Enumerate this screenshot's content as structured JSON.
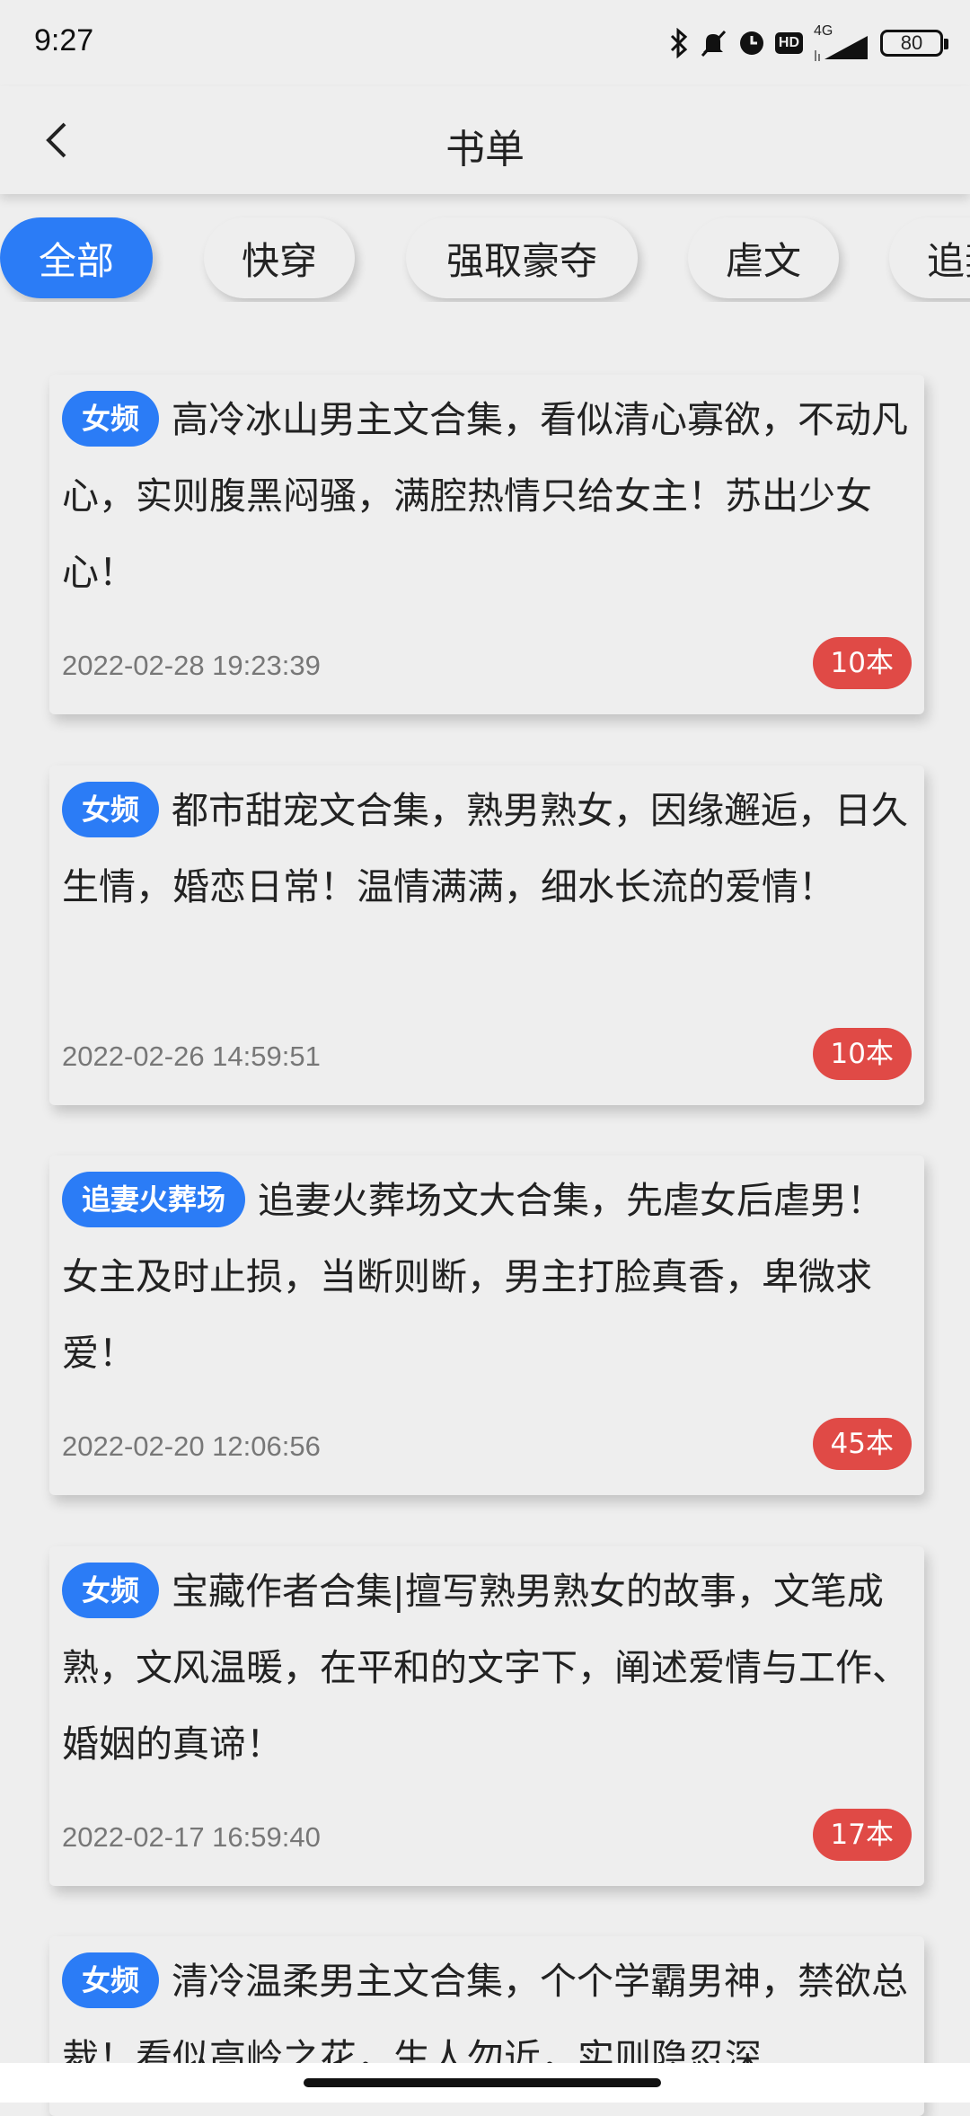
{
  "status_bar": {
    "time": "9:27",
    "icons": [
      "bluetooth-icon",
      "mute-icon",
      "alarm-icon",
      "hd-icon",
      "signal-icon",
      "battery-icon"
    ],
    "hd_label": "HD",
    "network": "4G",
    "battery": "80"
  },
  "header": {
    "title": "书单",
    "back_icon": "chevron-left-icon"
  },
  "tabs": [
    {
      "label": "全部",
      "active": true
    },
    {
      "label": "快穿",
      "active": false
    },
    {
      "label": "强取豪夺",
      "active": false
    },
    {
      "label": "虐文",
      "active": false
    },
    {
      "label": "追妻",
      "active": false
    }
  ],
  "colors": {
    "accent": "#2b7cf6",
    "count_badge": "#e04a46",
    "background": "#eeeeee"
  },
  "book_lists": [
    {
      "tag": "女频",
      "description": "高冷冰山男主文合集，看似清心寡欲，不动凡心，实则腹黑闷骚，满腔热情只给女主！苏出少女心！",
      "date": "2022-02-28 19:23:39",
      "count": "10本"
    },
    {
      "tag": "女频",
      "description": "都市甜宠文合集，熟男熟女，因缘邂逅，日久生情，婚恋日常！温情满满，细水长流的爱情！",
      "date": "2022-02-26 14:59:51",
      "count": "10本"
    },
    {
      "tag": "追妻火葬场",
      "description": "追妻火葬场文大合集，先虐女后虐男！女主及时止损，当断则断，男主打脸真香，卑微求爱！",
      "date": "2022-02-20 12:06:56",
      "count": "45本"
    },
    {
      "tag": "女频",
      "description": "宝藏作者合集|擅写熟男熟女的故事，文笔成熟，文风温暖，在平和的文字下，阐述爱情与工作、婚姻的真谛！",
      "date": "2022-02-17 16:59:40",
      "count": "17本"
    },
    {
      "tag": "女频",
      "description": "清冷温柔男主文合集，个个学霸男神，禁欲总裁！看似高岭之花，生人勿近，实则隐忍深"
    }
  ]
}
